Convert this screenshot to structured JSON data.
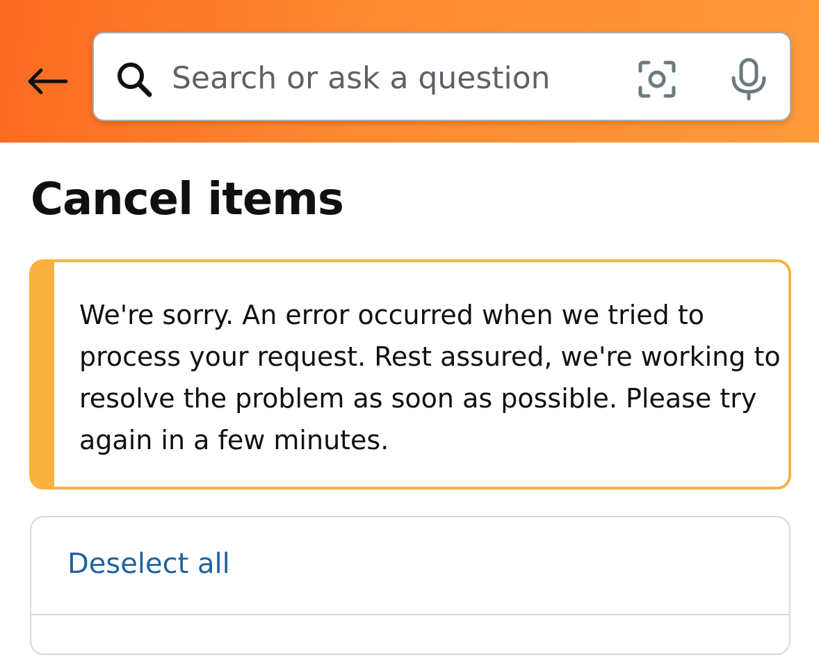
{
  "search": {
    "placeholder": "Search or ask a question"
  },
  "icons": {
    "back": "arrow-left-icon",
    "search": "search-icon",
    "camera": "camera-lens-icon",
    "mic": "microphone-icon"
  },
  "page": {
    "title": "Cancel items"
  },
  "alert": {
    "message": "We're sorry. An error occurred when we tried to process your request. Rest assured, we're working to resolve the problem as soon as possible. Please try again in a few minutes."
  },
  "items": {
    "deselect_label": "Deselect all"
  },
  "colors": {
    "header_gradient_start": "#fb6a22",
    "header_gradient_end": "#ff9a3a",
    "alert_border": "#f9b13f",
    "link": "#2162a1",
    "text": "#0f1111"
  }
}
